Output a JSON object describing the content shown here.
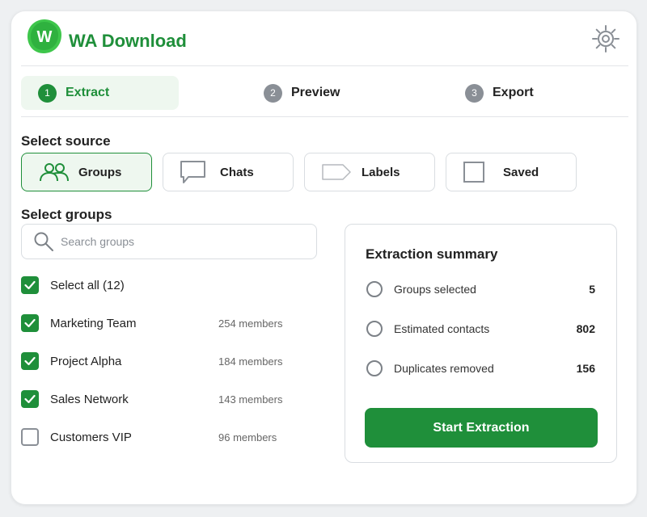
{
  "app": {
    "title": "WA Download",
    "logo_letter": "W",
    "brand_color": "#1f8f3a"
  },
  "steps": [
    {
      "num": "1",
      "label": "Extract",
      "active": true
    },
    {
      "num": "2",
      "label": "Preview",
      "active": false
    },
    {
      "num": "3",
      "label": "Export",
      "active": false
    }
  ],
  "source": {
    "title": "Select source",
    "options": [
      {
        "label": "Groups",
        "icon": "users-icon",
        "selected": true
      },
      {
        "label": "Chats",
        "icon": "chat-icon",
        "selected": false
      },
      {
        "label": "Labels",
        "icon": "tag-icon",
        "selected": false
      },
      {
        "label": "Saved",
        "icon": "square-icon",
        "selected": false
      }
    ]
  },
  "groups": {
    "title": "Select groups",
    "search_placeholder": "Search groups",
    "select_all_label": "Select all (12)",
    "items": [
      {
        "name": "Marketing Team",
        "members": "254 members",
        "checked": true
      },
      {
        "name": "Project Alpha",
        "members": "184 members",
        "checked": true
      },
      {
        "name": "Sales Network",
        "members": "143 members",
        "checked": true
      },
      {
        "name": "Customers VIP",
        "members": "96 members",
        "checked": false
      }
    ]
  },
  "summary": {
    "title": "Extraction summary",
    "rows": [
      {
        "label": "Groups selected",
        "value": "5"
      },
      {
        "label": "Estimated contacts",
        "value": "802"
      },
      {
        "label": "Duplicates removed",
        "value": "156"
      }
    ],
    "button_label": "Start Extraction"
  }
}
